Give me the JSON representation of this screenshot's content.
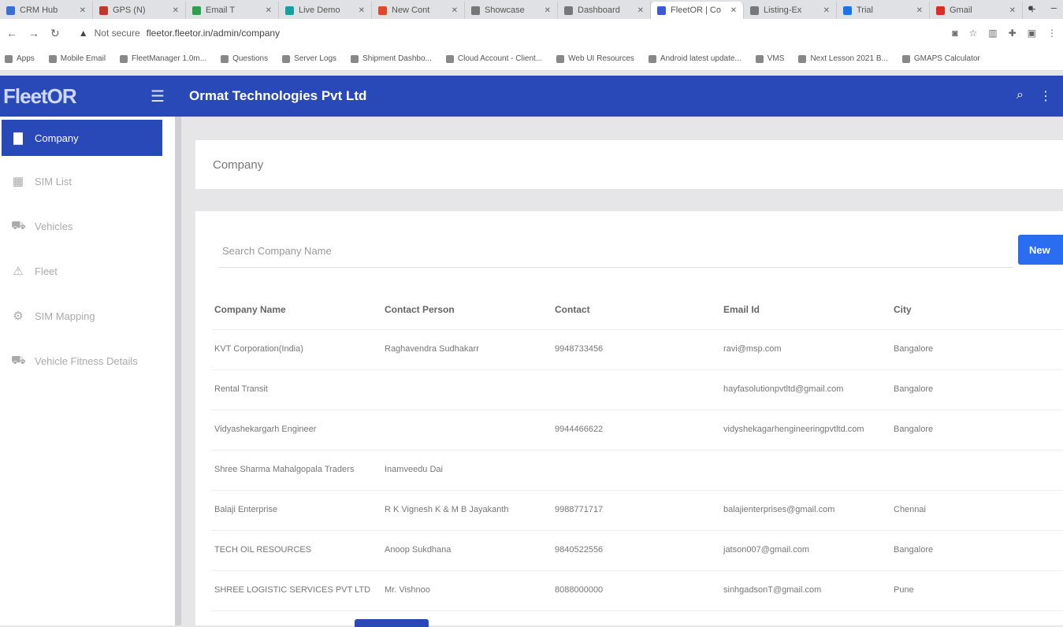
{
  "browser": {
    "tabs": [
      {
        "name": "CRM Hub",
        "color": "#3b6fd6"
      },
      {
        "name": "GPS (N)",
        "color": "#c0392b"
      },
      {
        "name": "Email T",
        "color": "#2e9e4f"
      },
      {
        "name": "Live Demo",
        "color": "#18a0a0"
      },
      {
        "name": "New Cont",
        "color": "#e04a2a"
      },
      {
        "name": "Showcase",
        "color": "#777777"
      },
      {
        "name": "Dashboard",
        "color": "#777777"
      },
      {
        "name": "FleetOR | Co",
        "color": "#3a5bd1"
      },
      {
        "name": "Listing-Ex",
        "color": "#777777"
      },
      {
        "name": "Trial",
        "color": "#1a73e8"
      },
      {
        "name": "Gmail",
        "color": "#d93025"
      }
    ],
    "active_tab": 7,
    "url_security": "Not secure",
    "url": "fleetor.fleetor.in/admin/company",
    "bookmarks": [
      "Apps",
      "Mobile Email",
      "FleetManager 1.0m...",
      "Questions",
      "Server Logs",
      "Shipment Dashbo...",
      "Cloud Account - Client...",
      "Web UI Resources",
      "Android latest update...",
      "VMS",
      "Next Lesson 2021 B...",
      "GMAPS Calculator"
    ]
  },
  "header": {
    "logo": "FleetOR",
    "org_name": "Ormat Technologies Pvt Ltd"
  },
  "sidebar": {
    "items": [
      {
        "label": "Company",
        "icon": "building-icon",
        "glyph": "▇"
      },
      {
        "label": "SIM List",
        "icon": "sim-card-icon",
        "glyph": "▦"
      },
      {
        "label": "Vehicles",
        "icon": "truck-icon",
        "glyph": "⛟"
      },
      {
        "label": "Fleet",
        "icon": "fleet-icon",
        "glyph": "⚠"
      },
      {
        "label": "SIM Mapping",
        "icon": "settings-icon",
        "glyph": "⚙"
      },
      {
        "label": "Vehicle Fitness Details",
        "icon": "vehicle-icon",
        "glyph": "⛟"
      }
    ],
    "active": 0
  },
  "main": {
    "breadcrumb": "Company",
    "search_placeholder": "Search Company Name",
    "new_button": "New",
    "columns": [
      "Company Name",
      "Contact Person",
      "Contact",
      "Email Id",
      "City"
    ],
    "rows": [
      [
        "KVT Corporation(India)",
        "Raghavendra Sudhakarr",
        "9948733456",
        "ravi@msp.com",
        "Bangalore"
      ],
      [
        "Rental Transit",
        "",
        "",
        "hayfasolutionpvtltd@gmail.com",
        "Bangalore"
      ],
      [
        "Vidyashekargarh Engineer",
        "",
        "9944466622",
        "vidyshekagarhengineeringpvtltd.com",
        "Bangalore"
      ],
      [
        "Shree Sharma Mahalgopala Traders",
        "Inamveedu Dai",
        "",
        "",
        ""
      ],
      [
        "Balaji Enterprise",
        "R K Vignesh K & M B Jayakanth",
        "9988771717",
        "balajienterprises@gmail.com",
        "Chennai"
      ],
      [
        "TECH OIL RESOURCES",
        "Anoop Sukdhana",
        "9840522556",
        "jatson007@gmail.com",
        "Bangalore"
      ],
      [
        "SHREE LOGISTIC SERVICES PVT LTD",
        "Mr. Vishnoo",
        "8088000000",
        "sinhgadsonT@gmail.com",
        "Pune"
      ]
    ]
  }
}
